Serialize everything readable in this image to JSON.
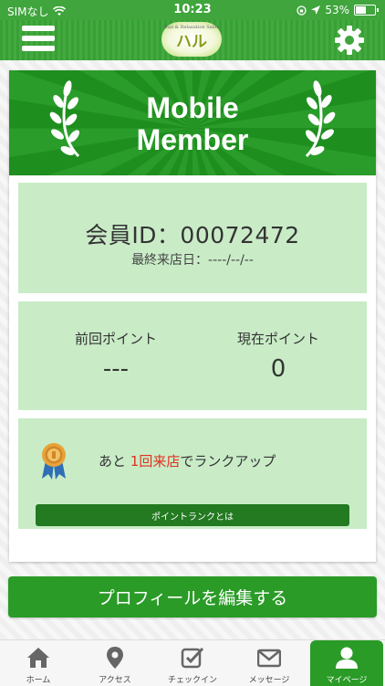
{
  "status_bar": {
    "carrier": "SIMなし",
    "time": "10:23",
    "battery": "53%",
    "battery_level": 0.53
  },
  "header": {
    "logo_text": "ハル",
    "logo_tagline": "Nail & Relaxation Salon",
    "menu_icon": "hamburger-icon",
    "settings_icon": "gear-icon"
  },
  "banner": {
    "title_line1": "Mobile",
    "title_line2": "Member"
  },
  "member": {
    "id_label": "会員ID：00072472",
    "last_visit": "最終来店日：----/--/--"
  },
  "points": {
    "previous_label": "前回ポイント",
    "previous_value": "---",
    "current_label": "現在ポイント",
    "current_value": "0"
  },
  "rank": {
    "prefix": "あと ",
    "highlight": "1回来店",
    "suffix": "でランクアップ",
    "button_label": "ポイントランクとは",
    "highlight_color": "#e0301e"
  },
  "profile_button": "プロフィールを編集する",
  "tabs": [
    {
      "label": "ホーム",
      "icon": "home-icon",
      "active": false
    },
    {
      "label": "アクセス",
      "icon": "location-pin-icon",
      "active": false
    },
    {
      "label": "チェックイン",
      "icon": "checkin-icon",
      "active": false
    },
    {
      "label": "メッセージ",
      "icon": "mail-icon",
      "active": false
    },
    {
      "label": "マイページ",
      "icon": "user-icon",
      "active": true
    }
  ],
  "colors": {
    "primary_green": "#2a9b27",
    "panel_green": "#c9ecc7",
    "dark_green": "#237a21"
  }
}
